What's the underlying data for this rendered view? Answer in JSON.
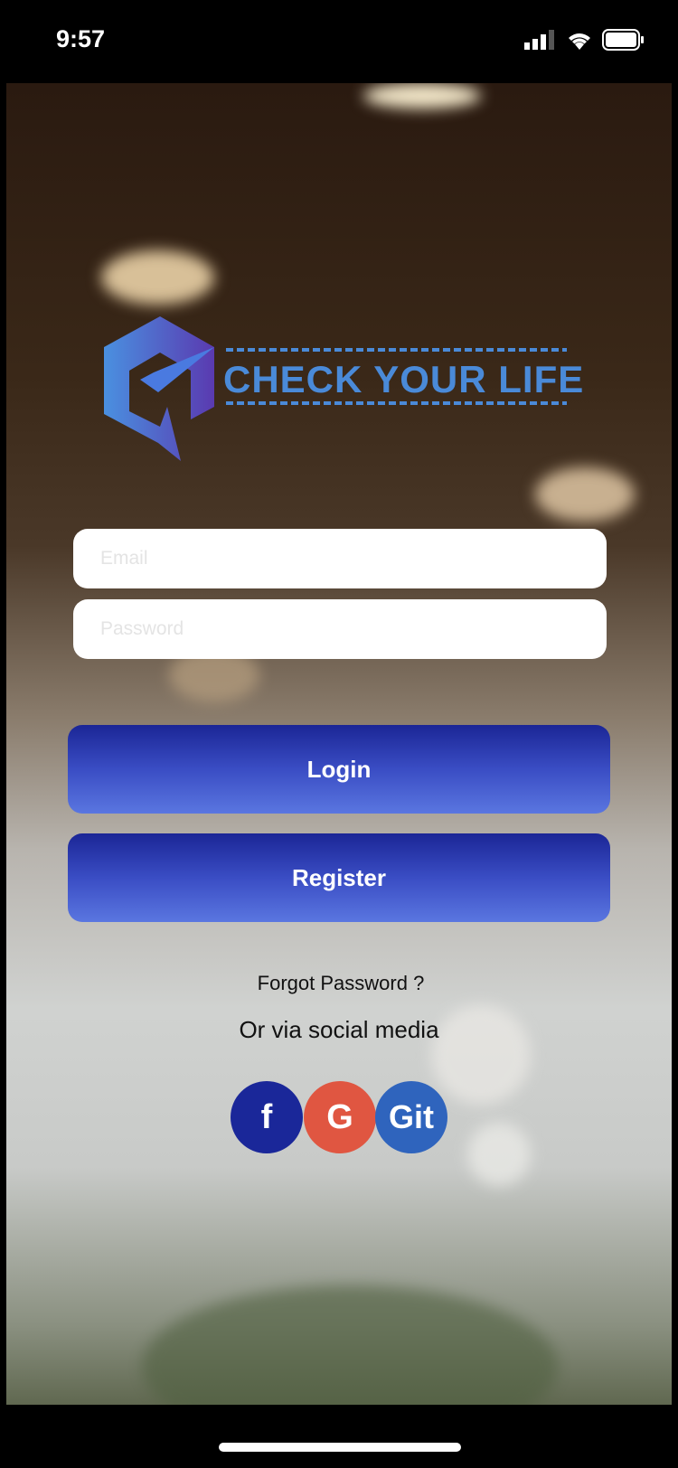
{
  "status_bar": {
    "time": "9:57"
  },
  "logo": {
    "text": "CHECK YOUR LIFE"
  },
  "form": {
    "email_placeholder": "Email",
    "password_placeholder": "Password"
  },
  "buttons": {
    "login": "Login",
    "register": "Register"
  },
  "links": {
    "forgot": "Forgot Password ?",
    "social_caption": "Or via social media"
  },
  "social": [
    {
      "label": "f",
      "color": "#1a2799"
    },
    {
      "label": "G",
      "color": "#e05641"
    },
    {
      "label": "Git",
      "color": "#2f64bd"
    }
  ]
}
